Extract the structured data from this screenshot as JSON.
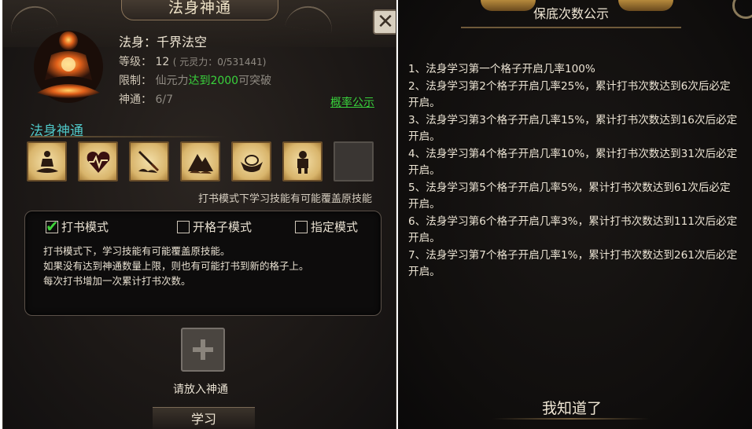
{
  "left": {
    "title": "法身神通",
    "close_label": "✕",
    "name_label": "法身：",
    "name_value": "千界法空",
    "level_label": "等级：",
    "level_value": "12",
    "level_detail": "( 元灵力：0/531441)",
    "limit_label": "限制：",
    "limit_prefix": "仙元力",
    "limit_highlight": "达到2000",
    "limit_suffix": "可突破",
    "skill_count_label": "神通：",
    "skill_count_value": "6/7",
    "rate_link": "概率公示",
    "section_title": "法身神通",
    "skills": [
      {
        "icon": "meditating-figure-icon"
      },
      {
        "icon": "heartbeat-icon"
      },
      {
        "icon": "sword-cloud-icon"
      },
      {
        "icon": "mountain-cloud-icon"
      },
      {
        "icon": "gold-ingot-icon"
      },
      {
        "icon": "armored-warrior-icon"
      },
      {
        "icon": "empty-slot"
      }
    ],
    "hint": "打书模式下学习技能有可能覆盖原技能",
    "modes": [
      {
        "label": "打书模式",
        "checked": true
      },
      {
        "label": "开格子模式",
        "checked": false
      },
      {
        "label": "指定模式",
        "checked": false
      }
    ],
    "desc_lines": [
      "打书模式下，学习技能有可能覆盖原技能。",
      "如果没有达到神通数量上限，则也有可能打书到新的格子上。",
      "每次打书增加一次累计打书次数。"
    ],
    "slot_label": "请放入神通",
    "learn_button": "学习",
    "colors": {
      "accent_green": "#39d23c",
      "section_cyan": "#4fc7c7"
    }
  },
  "right": {
    "title": "保底次数公示",
    "rules": [
      "1、法身学习第一个格子开启几率100%",
      "2、法身学习第2个格子开启几率25%，累计打书次数达到6次后必定开启。",
      "3、法身学习第3个格子开启几率15%，累计打书次数达到16次后必定开启。",
      "4、法身学习第4个格子开启几率10%，累计打书次数达到31次后必定开启。",
      "5、法身学习第5个格子开启几率5%，累计打书次数达到61次后必定开启。",
      "6、法身学习第6个格子开启几率3%，累计打书次数达到111次后必定开启。",
      "7、法身学习第7个格子开启几率1%，累计打书次数达到261次后必定开启。"
    ],
    "confirm_button": "我知道了"
  }
}
